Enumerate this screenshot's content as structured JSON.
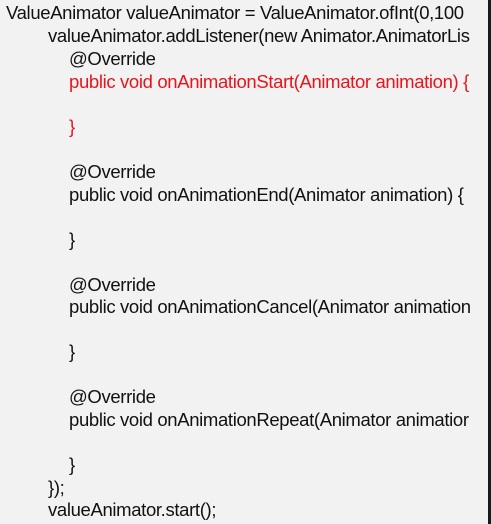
{
  "code": {
    "line_1": "ValueAnimator valueAnimator = ValueAnimator.ofInt(0,100",
    "line_2": "valueAnimator.addListener(new Animator.AnimatorLis",
    "line_3": "@Override",
    "line_4": "public void onAnimationStart(Animator animation) {",
    "line_5": "}",
    "line_6": "@Override",
    "line_7": "public void onAnimationEnd(Animator animation) {",
    "line_8": "}",
    "line_9": "@Override",
    "line_10": "public void onAnimationCancel(Animator animation",
    "line_11": "}",
    "line_12": "@Override",
    "line_13": "public void onAnimationRepeat(Animator animatior",
    "line_14": "}",
    "line_15": "});",
    "line_16": "valueAnimator.start();"
  },
  "colors": {
    "text": "#111111",
    "highlight": "#e8141c",
    "background": "#f2f2f2"
  }
}
